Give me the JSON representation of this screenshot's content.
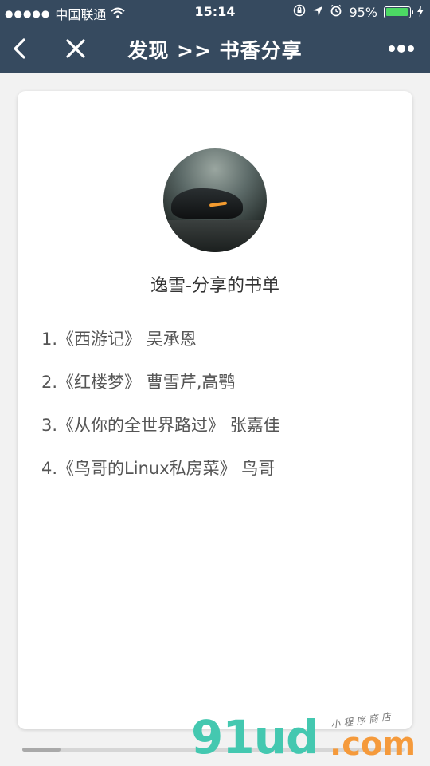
{
  "status_bar": {
    "signal": "●●●●●",
    "carrier": "中国联通",
    "time": "15:14",
    "battery_percent": "95%",
    "battery_level": 0.95,
    "colors": {
      "battery_fill": "#4cd964"
    }
  },
  "nav": {
    "title": "发现 >> 书香分享",
    "background": "#364a5f"
  },
  "card": {
    "title": "逸雪-分享的书单",
    "books": [
      "1.《西游记》 吴承恩",
      "2.《红楼梦》 曹雪芹,高鹗",
      "3.《从你的全世界路过》 张嘉佳",
      "4.《鸟哥的Linux私房菜》 鸟哥"
    ]
  },
  "scroll_position": 0.1,
  "watermark": {
    "main": "91ud",
    "domain": ".com",
    "tagline": "小程序商店"
  }
}
